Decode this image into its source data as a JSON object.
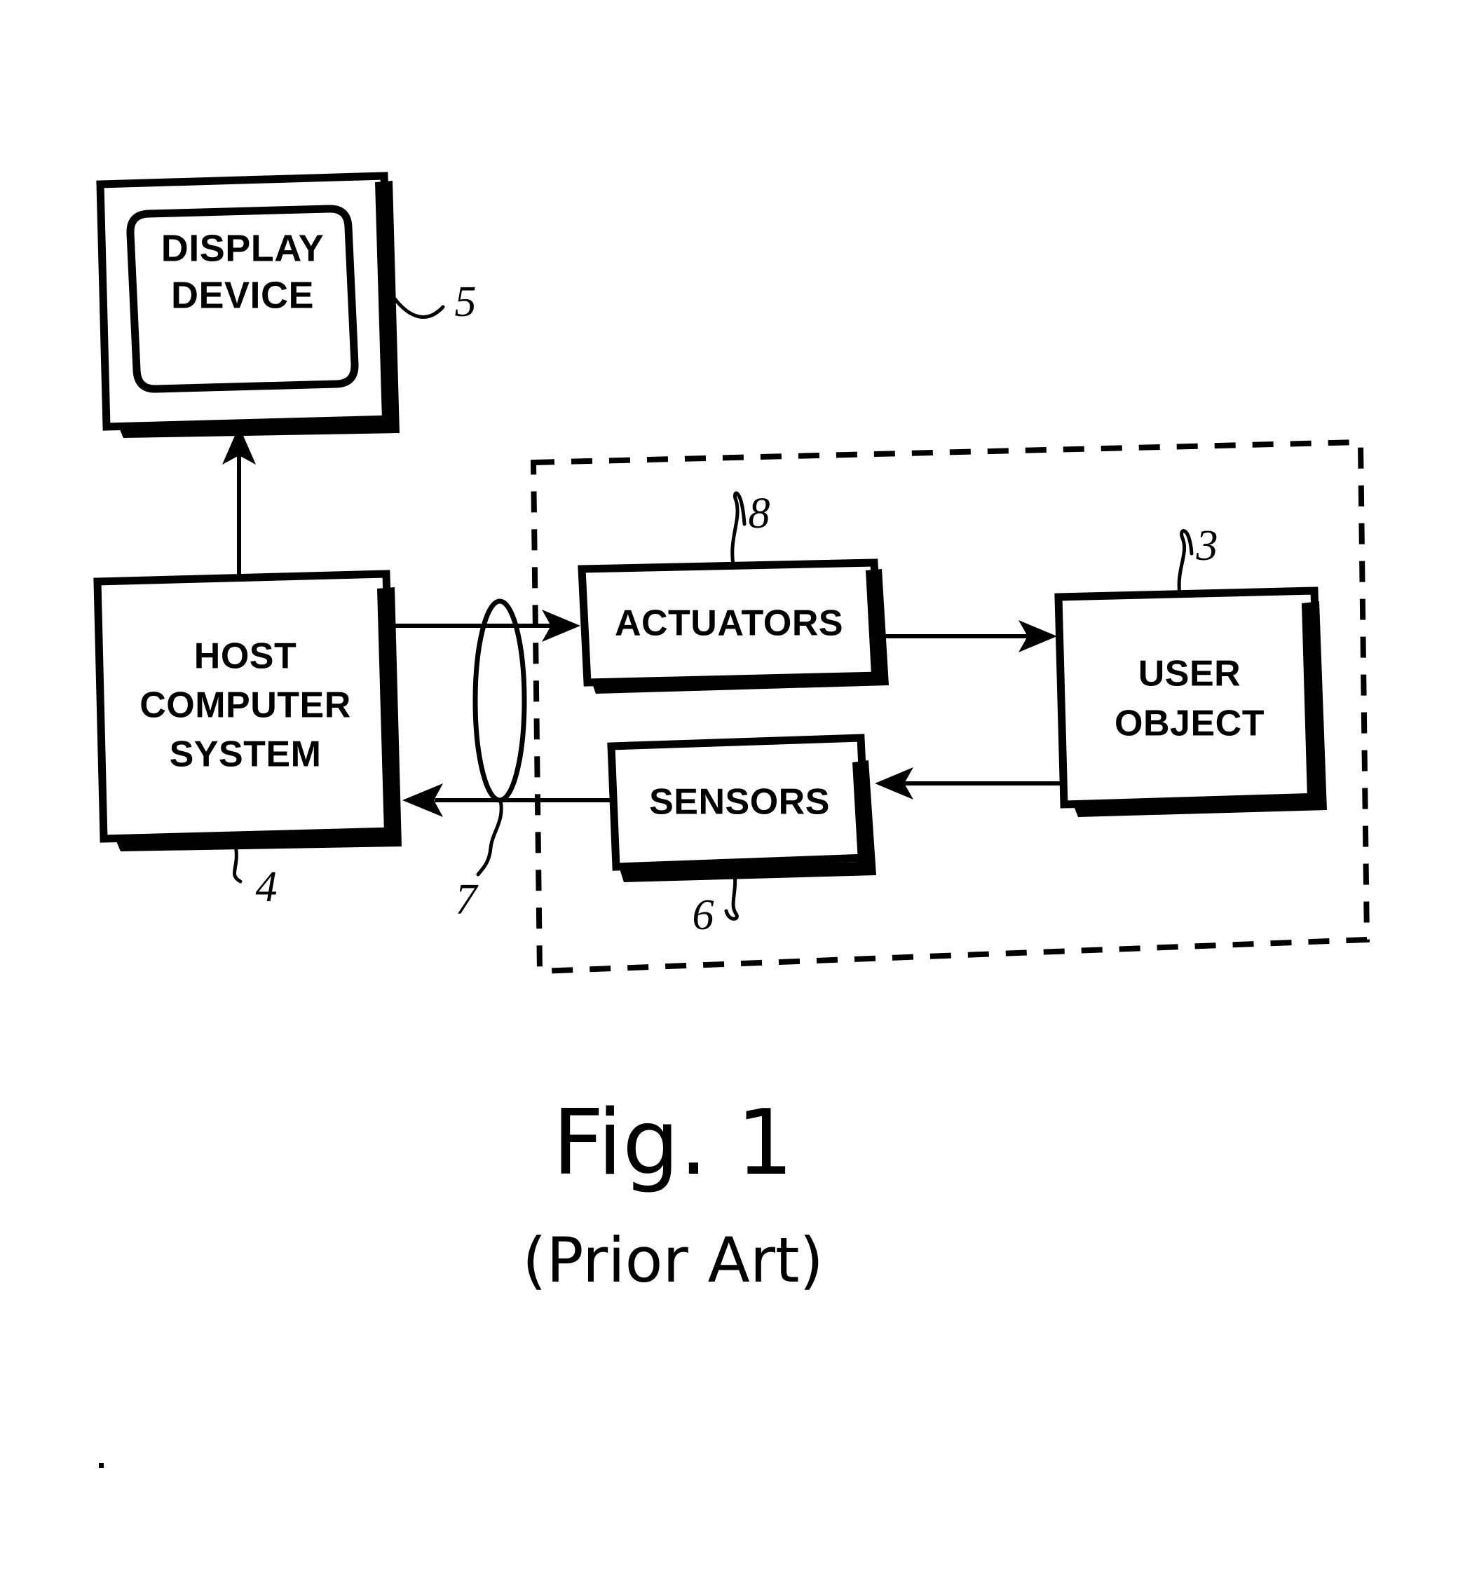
{
  "figure": {
    "caption": "Fig. 1",
    "subcaption": "(Prior Art)"
  },
  "blocks": [
    {
      "id": "display-device",
      "label_line1": "DISPLAY",
      "label_line2": "DEVICE",
      "ref": "5",
      "shape": "screen"
    },
    {
      "id": "host-computer-system",
      "label_line1": "HOST",
      "label_line2": "COMPUTER",
      "label_line3": "SYSTEM",
      "ref": "4",
      "shape": "rect"
    },
    {
      "id": "actuators",
      "label_line1": "ACTUATORS",
      "ref": "8",
      "shape": "rect"
    },
    {
      "id": "sensors",
      "label_line1": "SENSORS",
      "ref": "6",
      "shape": "rect"
    },
    {
      "id": "user-object",
      "label_line1": "USER",
      "label_line2": "OBJECT",
      "ref": "3",
      "shape": "rect"
    }
  ],
  "interface": {
    "id": "interface-ellipse",
    "ref": "7"
  },
  "region": {
    "id": "interface-device-region",
    "style": "dashed"
  },
  "connections": [
    {
      "from": "host-computer-system",
      "to": "display-device",
      "direction": "up"
    },
    {
      "from": "host-computer-system",
      "to": "actuators",
      "direction": "right"
    },
    {
      "from": "actuators",
      "to": "user-object",
      "direction": "right"
    },
    {
      "from": "user-object",
      "to": "sensors",
      "direction": "left"
    },
    {
      "from": "sensors",
      "to": "host-computer-system",
      "direction": "left"
    }
  ],
  "colors": {
    "ink": "#000000",
    "paper": "#ffffff"
  }
}
